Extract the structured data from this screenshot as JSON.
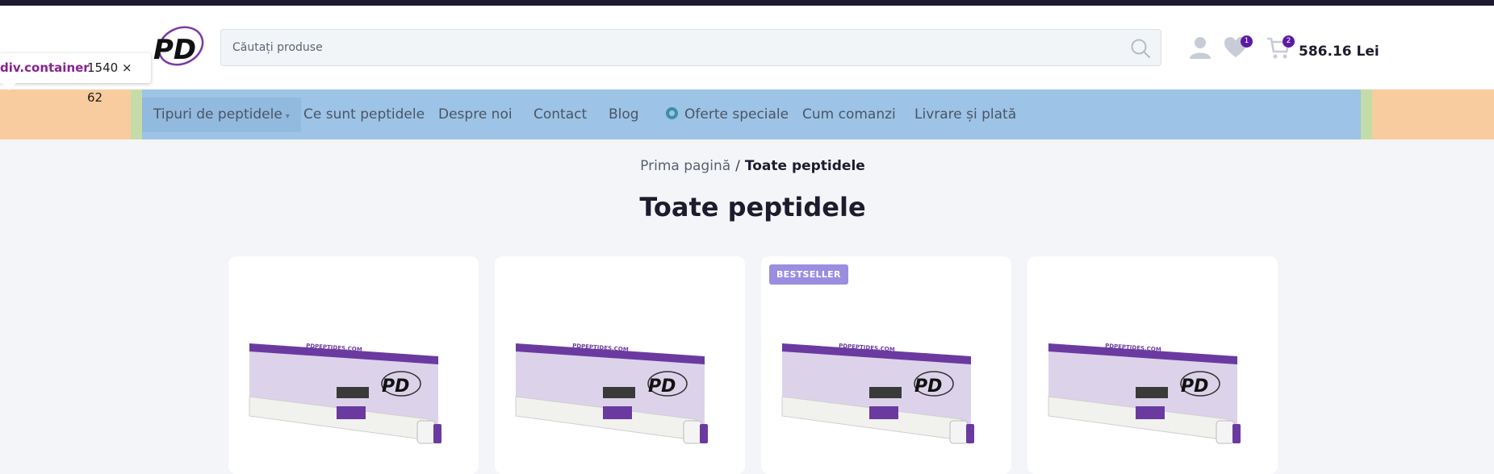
{
  "header": {
    "logo_text": "PD",
    "search": {
      "placeholder": "Căutați produse",
      "value": ""
    },
    "wishlist_count": "1",
    "cart_count": "2",
    "cart_total": "586.16 Lei"
  },
  "devtools_tooltip": {
    "element_name": "div.container",
    "size": "1540 × 62"
  },
  "nav": {
    "items": [
      {
        "label": "Tipuri de peptidele",
        "has_dropdown": true,
        "active": true
      },
      {
        "label": "Ce sunt peptidele"
      },
      {
        "label": "Despre noi"
      },
      {
        "label": "Contact"
      },
      {
        "label": "Blog"
      },
      {
        "label": "Oferte speciale",
        "icon": "gear-icon"
      },
      {
        "label": "Cum comanzi"
      },
      {
        "label": "Livrare și plată"
      }
    ]
  },
  "breadcrumb": {
    "home": "Prima pagină",
    "separator": "/",
    "current": "Toate peptidele"
  },
  "page_title": "Toate peptidele",
  "products": [
    {
      "badge": "",
      "box_brand": "PDPEPTIDES.COM"
    },
    {
      "badge": "",
      "box_brand": "PDPEPTIDES.COM"
    },
    {
      "badge": "BESTSELLER",
      "box_brand": "PDPEPTIDES.COM"
    },
    {
      "badge": "",
      "box_brand": "PDPEPTIDES.COM"
    }
  ],
  "colors": {
    "accent": "#5a1ca3",
    "badge_bg": "#9b8ee0",
    "nav_bg": "#9dc3e6",
    "nav_margin": "#f8cc9e",
    "nav_padding": "#c4dca8"
  }
}
